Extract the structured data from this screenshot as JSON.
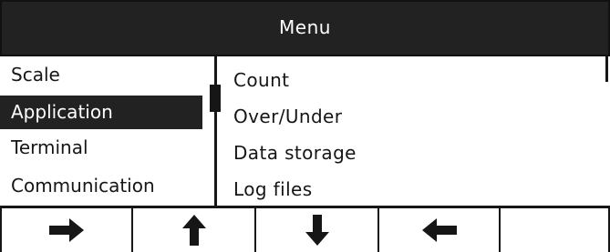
{
  "header": {
    "title": "Menu"
  },
  "left_menu": {
    "items": [
      {
        "label": "Scale"
      },
      {
        "label": "Application"
      },
      {
        "label": "Terminal"
      },
      {
        "label": "Communication"
      }
    ],
    "selected_label": "Application"
  },
  "right_menu": {
    "items": [
      {
        "label": "Count"
      },
      {
        "label": "Over/Under"
      },
      {
        "label": "Data storage"
      },
      {
        "label": "Log files"
      }
    ]
  },
  "softkeys": [
    {
      "icon": "arrow-right-icon"
    },
    {
      "icon": "arrow-up-icon"
    },
    {
      "icon": "arrow-down-icon"
    },
    {
      "icon": "arrow-left-icon"
    },
    {
      "icon": ""
    }
  ],
  "colors": {
    "background": "#ffffff",
    "foreground": "#161616",
    "header_bg": "#222222",
    "selected_bg": "#222222"
  }
}
